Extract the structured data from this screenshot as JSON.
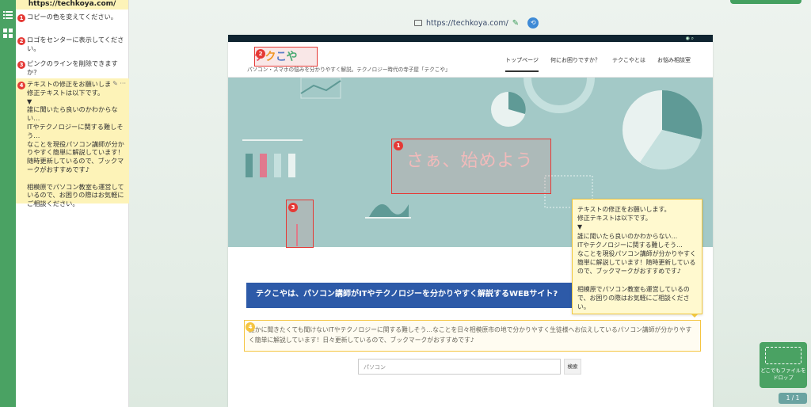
{
  "sidebar": {
    "url": "https://techkoya.com/",
    "comments": [
      {
        "num": "1",
        "text": "コピーの色を変えてください。"
      },
      {
        "num": "2",
        "text": "ロゴをセンターに表示してください。"
      },
      {
        "num": "3",
        "text": "ピンクのラインを削除できますか？"
      },
      {
        "num": "4",
        "text": "テキストの修正をお願いしま\n修正テキストは以下です。\n▼\n誰に聞いたら良いのかわからない…\nITやテクノロジーに関する難しそう…\nなことを現役パソコン講師が分かりやすく簡単に解説しています！随時更新しているので、ブックマークがおすすめです♪\n\n相模原でパソコン教室も運営しているので、お困りの際はお気軽にご相談ください。"
      }
    ],
    "tools": "✎ ···"
  },
  "toolbar": {
    "url": "https://techkoya.com/"
  },
  "site": {
    "logo": {
      "t": "テ",
      "k": "ク",
      "ko": "こ",
      "ya": "や"
    },
    "tagline": "パソコン・スマホの悩みを分かりやすく解説。テクノロジー時代の寺子屋「テクこや」",
    "nav": [
      "トップページ",
      "何にお困りですか？",
      "テクこやとは",
      "お悩み相談室"
    ],
    "hero_title": "さぁ、始めよう",
    "banner": "テクこやは、パソコン講師がITやテクノロジーを分かりやすく解説するWEBサイト?",
    "intro": "誰かに聞きたくても聞けないITやテクノロジーに関する難しそう…なことを日々相模原市の地で分かりやすく生徒様へお伝えしているパソコン講師が分かりやすく簡単に解説しています！日々更新しているので、ブックマークがおすすめです♪",
    "search_placeholder": "パソコン",
    "search_button": "検索"
  },
  "annotations": {
    "pins": [
      "1",
      "2",
      "3",
      "4"
    ]
  },
  "popup": {
    "text": "テキストの修正をお願いします。\n修正テキストは以下です。\n▼\n誰に聞いたら良いのかわからない…\nITやテクノロジーに関する難しそう…\nなことを現役パソコン講師が分かりやすく簡単に解説しています！随時更新しているので、ブックマークがおすすめです♪\n\n相模原でパソコン教室も運営しているので、お困りの際はお気軽にご相談ください。"
  },
  "drop_zone": {
    "label": "どこでもファイルをドロップ"
  },
  "pager": "1 / 1",
  "colors": {
    "accent": "#4aa263",
    "pin": "#e53935",
    "note": "#fdf3b8",
    "banner": "#2d5aa8"
  }
}
